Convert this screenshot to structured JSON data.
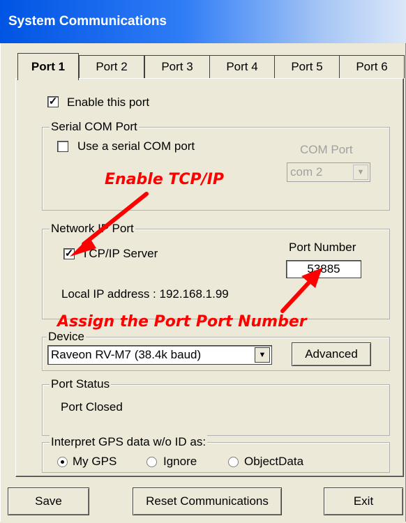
{
  "window": {
    "title": "System Communications"
  },
  "tabs": [
    {
      "label": "Port 1",
      "active": true
    },
    {
      "label": "Port 2"
    },
    {
      "label": "Port 3"
    },
    {
      "label": "Port 4"
    },
    {
      "label": "Port 5"
    },
    {
      "label": "Port 6"
    }
  ],
  "enable_port": {
    "label": "Enable this port",
    "checked": true
  },
  "serial": {
    "legend": "Serial COM Port",
    "use_label": "Use a serial COM port",
    "use_checked": false,
    "com_port_label": "COM Port",
    "com_port_value": "com 2"
  },
  "network": {
    "legend": "Network IP Port",
    "tcp_label": "TCP/IP Server",
    "tcp_checked": true,
    "port_number_label": "Port Number",
    "port_number_value": "53885",
    "local_ip_text": "Local IP address : 192.168.1.99"
  },
  "device": {
    "legend": "Device",
    "value": "Raveon RV-M7 (38.4k baud)",
    "advanced_label": "Advanced"
  },
  "port_status": {
    "legend": "Port Status",
    "value": "Port Closed"
  },
  "gps": {
    "legend": "Interpret GPS data w/o ID as:",
    "options": [
      {
        "label": "My GPS",
        "selected": true
      },
      {
        "label": "Ignore",
        "selected": false
      },
      {
        "label": "ObjectData",
        "selected": false
      }
    ]
  },
  "buttons": {
    "save": "Save",
    "reset": "Reset Communications",
    "exit": "Exit"
  },
  "annotations": {
    "enable_tcp": "Enable TCP/IP",
    "assign_port": "Assign the Port Port Number",
    "color": "#ff0000"
  },
  "icons": {
    "check": "checkmark-icon",
    "dropdown": "chevron-down-icon",
    "arrow": "red-arrow-icon"
  }
}
